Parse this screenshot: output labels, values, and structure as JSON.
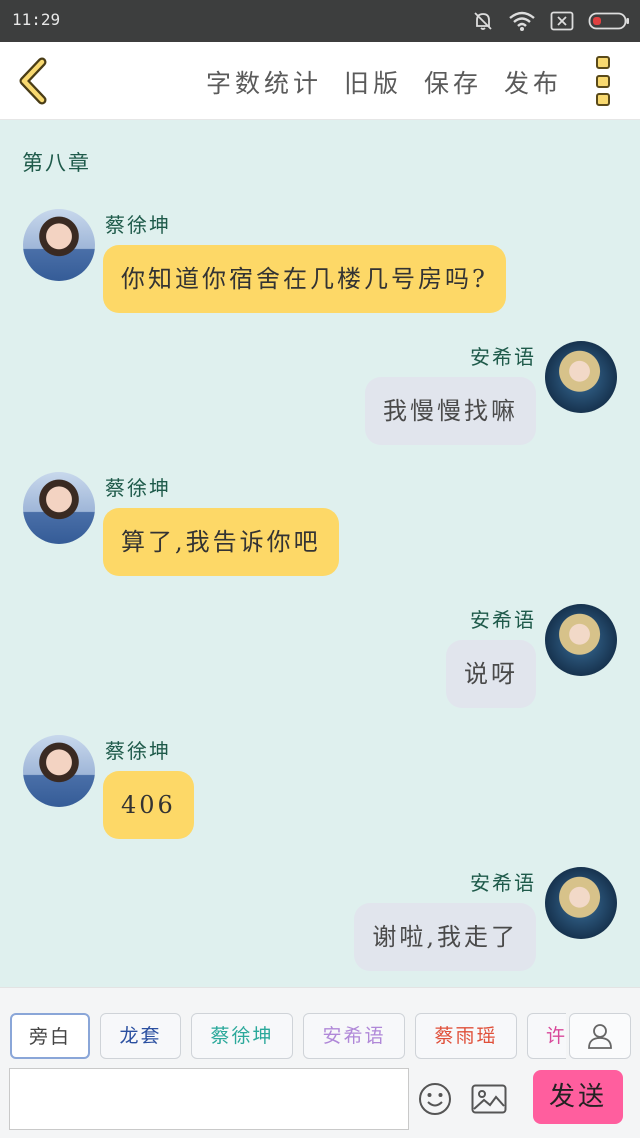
{
  "status_bar": {
    "time": "11:29",
    "icons": [
      "bell-off-icon",
      "wifi-icon",
      "sim-x-icon",
      "battery-icon"
    ]
  },
  "topbar": {
    "back_icon": "chevron-left-icon",
    "actions": [
      "字数统计",
      "旧版",
      "保存",
      "发布"
    ],
    "more_icon": "more-vertical-icon",
    "accent": "#f8d970"
  },
  "chat": {
    "chapter_title": "第八章",
    "messages": [
      {
        "side": "left",
        "speaker": "蔡徐坤",
        "text": "你知道你宿舍在几楼几号房吗?"
      },
      {
        "side": "right",
        "speaker": "安希语",
        "text": "我慢慢找嘛"
      },
      {
        "side": "left",
        "speaker": "蔡徐坤",
        "text": "算了,我告诉你吧"
      },
      {
        "side": "right",
        "speaker": "安希语",
        "text": "说呀"
      },
      {
        "side": "left",
        "speaker": "蔡徐坤",
        "text": "406"
      },
      {
        "side": "right",
        "speaker": "安希语",
        "text": "谢啦,我走了"
      }
    ],
    "left_bubble_color": "#fdd867",
    "right_bubble_color": "#e1e5ed"
  },
  "bottom": {
    "roles": [
      {
        "label": "旁白",
        "color": "#444444"
      },
      {
        "label": "龙套",
        "color": "#2a4fa0"
      },
      {
        "label": "蔡徐坤",
        "color": "#2aa89a"
      },
      {
        "label": "安希语",
        "color": "#b088d8"
      },
      {
        "label": "蔡雨瑶",
        "color": "#e0503a"
      },
      {
        "label": "许",
        "color": "#d8489a"
      }
    ],
    "selected_role": "旁白",
    "input_value": "",
    "emoji_icon": "smiley-icon",
    "image_icon": "image-icon",
    "role_user_icon": "user-icon",
    "send_label": "发送",
    "send_color": "#ff5e9e"
  }
}
